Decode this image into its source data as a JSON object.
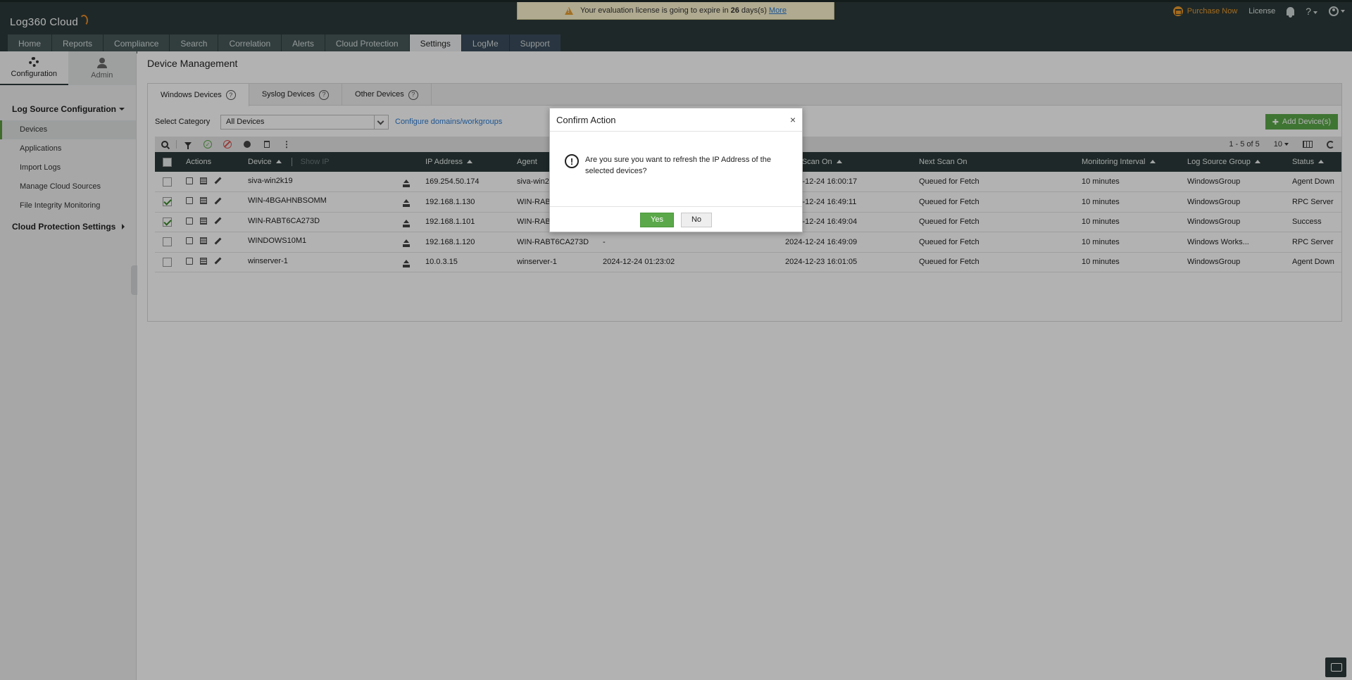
{
  "app": {
    "logo_text": "Log360 Cloud"
  },
  "notice": {
    "text_before": "Your evaluation license is going to expire in",
    "days": "26",
    "text_after": "days(s)",
    "more": "More"
  },
  "top_right": {
    "purchase": "Purchase Now",
    "license": "License",
    "help": "?"
  },
  "tabs": [
    "Home",
    "Reports",
    "Compliance",
    "Search",
    "Correlation",
    "Alerts",
    "Cloud Protection",
    "Settings",
    "LogMe",
    "Support"
  ],
  "sidebar": {
    "tabs": {
      "config": "Configuration",
      "admin": "Admin"
    },
    "section1": "Log Source Configuration",
    "items": [
      "Devices",
      "Applications",
      "Import Logs",
      "Manage Cloud Sources",
      "File Integrity Monitoring"
    ],
    "section2": "Cloud Protection Settings"
  },
  "main": {
    "title": "Device Management",
    "device_tabs": [
      "Windows Devices",
      "Syslog Devices",
      "Other Devices"
    ],
    "select_category_label": "Select Category",
    "select_category_value": "All Devices",
    "configure_link": "Configure domains/workgroups",
    "add_button": "Add Device(s)",
    "pagination": "1 - 5 of 5",
    "page_size": "10"
  },
  "table": {
    "headers": {
      "actions": "Actions",
      "device": "Device",
      "show_ip": "Show IP",
      "ip": "IP Address",
      "agent": "Agent",
      "last_scan": "Last Scan On",
      "next_scan": "Next Scan On",
      "interval": "Monitoring Interval",
      "group": "Log Source Group",
      "status": "Status"
    },
    "rows": [
      {
        "checked": false,
        "device": "siva-win2k19",
        "ip": "169.254.50.174",
        "agent": "siva-win2k19",
        "agent_time": "",
        "last_scan": "2024-12-24 16:00:17",
        "next_scan": "Queued for Fetch",
        "interval": "10 minutes",
        "group": "WindowsGroup",
        "status": "Agent Down",
        "status_type": "orange"
      },
      {
        "checked": true,
        "device": "WIN-4BGAHNBSOMM",
        "ip": "192.168.1.130",
        "agent": "WIN-RABT6CA273D",
        "agent_time": "",
        "last_scan": "2024-12-24 16:49:11",
        "next_scan": "Queued for Fetch",
        "interval": "10 minutes",
        "group": "WindowsGroup",
        "status": "RPC Server",
        "status_type": "orange"
      },
      {
        "checked": true,
        "device": "WIN-RABT6CA273D",
        "ip": "192.168.1.101",
        "agent": "WIN-RABT6CA273D",
        "agent_time": "",
        "last_scan": "2024-12-24 16:49:04",
        "next_scan": "Queued for Fetch",
        "interval": "10 minutes",
        "group": "WindowsGroup",
        "status": "Success",
        "status_type": "green"
      },
      {
        "checked": false,
        "device": "WINDOWS10M1",
        "ip": "192.168.1.120",
        "agent": "WIN-RABT6CA273D",
        "agent_time": "-",
        "last_scan": "2024-12-24 16:49:09",
        "next_scan": "Queued for Fetch",
        "interval": "10 minutes",
        "group": "Windows Works...",
        "status": "RPC Server",
        "status_type": "orange"
      },
      {
        "checked": false,
        "device": "winserver-1",
        "ip": "10.0.3.15",
        "agent": "winserver-1",
        "agent_time": "2024-12-24 01:23:02",
        "last_scan": "2024-12-23 16:01:05",
        "next_scan": "Queued for Fetch",
        "interval": "10 minutes",
        "group": "WindowsGroup",
        "status": "Agent Down",
        "status_type": "orange"
      }
    ]
  },
  "dialog": {
    "title": "Confirm Action",
    "close": "×",
    "message": "Are you sure you want to refresh the IP Address of the selected devices?",
    "yes": "Yes",
    "no": "No"
  },
  "colors": {
    "header_bg": "#2d3a3a",
    "accent_green": "#5ba84a",
    "link": "#2b7cd3",
    "status_orange": "#d87b1c",
    "purchase_orange": "#e89a2f"
  }
}
